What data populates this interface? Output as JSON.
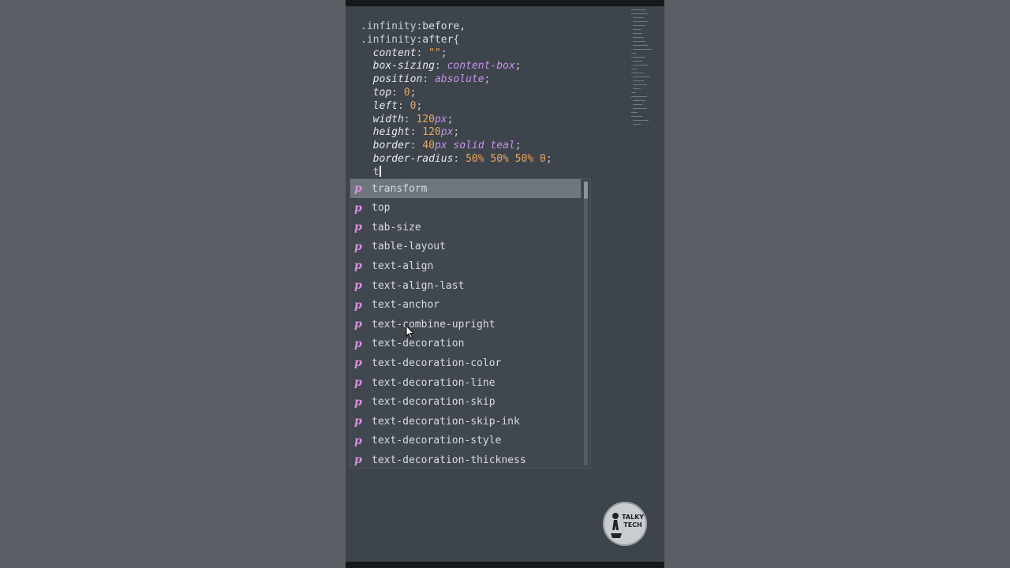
{
  "editor": {
    "lines": [
      {
        "parts": [
          {
            "t": ".infinity",
            "c": "sel-cls"
          },
          {
            "t": ":before,",
            "c": "sel"
          }
        ]
      },
      {
        "parts": [
          {
            "t": ".infinity",
            "c": "sel-cls"
          },
          {
            "t": ":after{",
            "c": "sel"
          }
        ]
      },
      {
        "parts": [
          {
            "t": "  content",
            "c": "prop"
          },
          {
            "t": ": ",
            "c": "punc"
          },
          {
            "t": "\"\"",
            "c": "str"
          },
          {
            "t": ";",
            "c": "punc"
          }
        ]
      },
      {
        "parts": [
          {
            "t": "  box-sizing",
            "c": "prop"
          },
          {
            "t": ": ",
            "c": "punc"
          },
          {
            "t": "content-box",
            "c": "kw"
          },
          {
            "t": ";",
            "c": "punc"
          }
        ]
      },
      {
        "parts": [
          {
            "t": "  position",
            "c": "prop"
          },
          {
            "t": ": ",
            "c": "punc"
          },
          {
            "t": "absolute",
            "c": "kw"
          },
          {
            "t": ";",
            "c": "punc"
          }
        ]
      },
      {
        "parts": [
          {
            "t": "  top",
            "c": "prop"
          },
          {
            "t": ": ",
            "c": "punc"
          },
          {
            "t": "0",
            "c": "num"
          },
          {
            "t": ";",
            "c": "punc"
          }
        ]
      },
      {
        "parts": [
          {
            "t": "  left",
            "c": "prop"
          },
          {
            "t": ": ",
            "c": "punc"
          },
          {
            "t": "0",
            "c": "num"
          },
          {
            "t": ";",
            "c": "punc"
          }
        ]
      },
      {
        "parts": [
          {
            "t": "  width",
            "c": "prop"
          },
          {
            "t": ": ",
            "c": "punc"
          },
          {
            "t": "120",
            "c": "num"
          },
          {
            "t": "px",
            "c": "unit"
          },
          {
            "t": ";",
            "c": "punc"
          }
        ]
      },
      {
        "parts": [
          {
            "t": "  height",
            "c": "prop"
          },
          {
            "t": ": ",
            "c": "punc"
          },
          {
            "t": "120",
            "c": "num"
          },
          {
            "t": "px",
            "c": "unit"
          },
          {
            "t": ";",
            "c": "punc"
          }
        ]
      },
      {
        "parts": [
          {
            "t": "  border",
            "c": "prop"
          },
          {
            "t": ": ",
            "c": "punc"
          },
          {
            "t": "40",
            "c": "num"
          },
          {
            "t": "px solid teal",
            "c": "kw"
          },
          {
            "t": ";",
            "c": "punc"
          }
        ]
      },
      {
        "parts": [
          {
            "t": "  border-radius",
            "c": "prop"
          },
          {
            "t": ": ",
            "c": "punc"
          },
          {
            "t": "50% 50% 50% 0",
            "c": "num"
          },
          {
            "t": ";",
            "c": "punc"
          }
        ]
      },
      {
        "parts": [
          {
            "t": "  t",
            "c": "sel"
          }
        ],
        "cursor": true
      }
    ]
  },
  "autocomplete": {
    "typed": "t",
    "icon": "p",
    "selected_index": 0,
    "items": [
      "transform",
      "top",
      "tab-size",
      "table-layout",
      "text-align",
      "text-align-last",
      "text-anchor",
      "text-combine-upright",
      "text-decoration",
      "text-decoration-color",
      "text-decoration-line",
      "text-decoration-skip",
      "text-decoration-skip-ink",
      "text-decoration-style",
      "text-decoration-thickness"
    ]
  },
  "watermark": {
    "text": "TALKY TECH"
  },
  "colors": {
    "editor_bg": "#3e444b",
    "popup_bg": "#41474e",
    "selected_bg": "#6f767e",
    "property_icon": "#d98ee0",
    "number": "#e8a65b",
    "keyword": "#c792ea"
  }
}
